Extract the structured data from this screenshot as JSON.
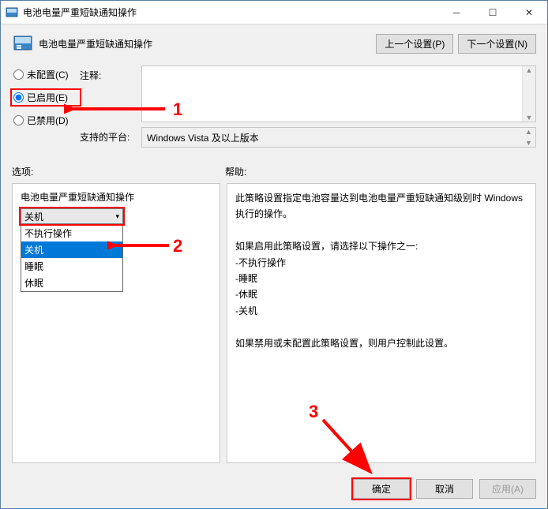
{
  "window": {
    "title": "电池电量严重短缺通知操作"
  },
  "header": {
    "title": "电池电量严重短缺通知操作",
    "prev_btn": "上一个设置(P)",
    "next_btn": "下一个设置(N)"
  },
  "radios": {
    "not_configured": "未配置(C)",
    "enabled": "已启用(E)",
    "disabled": "已禁用(D)"
  },
  "labels": {
    "comment": "注释:",
    "platform": "支持的平台:",
    "options": "选项:",
    "help": "帮助:"
  },
  "platform_value": "Windows Vista 及以上版本",
  "options_panel": {
    "title": "电池电量严重短缺通知操作",
    "selected": "关机",
    "items": [
      "不执行操作",
      "关机",
      "睡眠",
      "休眠"
    ]
  },
  "help_text": {
    "p1": "此策略设置指定电池容量达到电池电量严重短缺通知级别时 Windows 执行的操作。",
    "p2": "如果启用此策略设置，请选择以下操作之一:",
    "l1": "-不执行操作",
    "l2": "-睡眠",
    "l3": "-休眠",
    "l4": "-关机",
    "p3": "如果禁用或未配置此策略设置，则用户控制此设置。"
  },
  "footer": {
    "ok": "确定",
    "cancel": "取消",
    "apply": "应用(A)"
  },
  "annotations": {
    "a1": "1",
    "a2": "2",
    "a3": "3"
  }
}
